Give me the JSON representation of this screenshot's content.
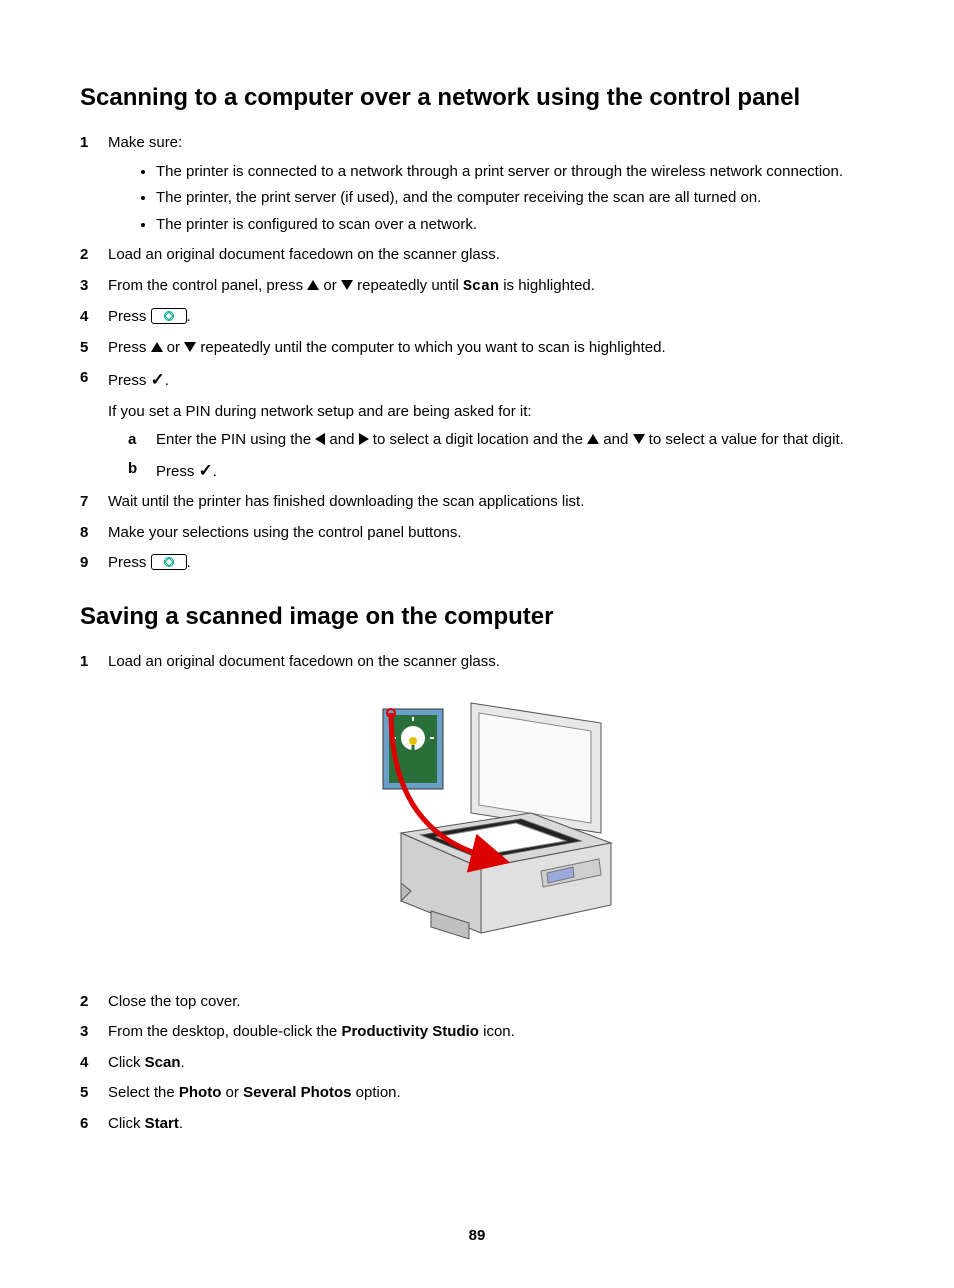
{
  "section1": {
    "heading": "Scanning to a computer over a network using the control panel",
    "step1_num": "1",
    "step1_text": "Make sure:",
    "step1_b1": "The printer is connected to a network through a print server or through the wireless network connection.",
    "step1_b2": "The printer, the print server (if used), and the computer receiving the scan are all turned on.",
    "step1_b3": "The printer is configured to scan over a network.",
    "step2_num": "2",
    "step2_text": "Load an original document facedown on the scanner glass.",
    "step3_num": "3",
    "step3_a": "From the control panel, press ",
    "step3_b": " or ",
    "step3_c": " repeatedly until ",
    "step3_scan": "Scan",
    "step3_d": " is highlighted.",
    "step4_num": "4",
    "step4_a": "Press ",
    "step4_b": ".",
    "step5_num": "5",
    "step5_a": "Press ",
    "step5_b": " or ",
    "step5_c": " repeatedly until the computer to which you want to scan is highlighted.",
    "step6_num": "6",
    "step6_a": "Press ",
    "step6_b": ".",
    "step6_note": "If you set a PIN during network setup and are being asked for it:",
    "step6_sub_a_l": "a",
    "step6_sub_a_1": "Enter the PIN using the ",
    "step6_sub_a_2": " and ",
    "step6_sub_a_3": " to select a digit location and the ",
    "step6_sub_a_4": " and ",
    "step6_sub_a_5": " to select a value for that digit.",
    "step6_sub_b_l": "b",
    "step6_sub_b_1": "Press ",
    "step6_sub_b_2": ".",
    "step7_num": "7",
    "step7_text": "Wait until the printer has finished downloading the scan applications list.",
    "step8_num": "8",
    "step8_text": "Make your selections using the control panel buttons.",
    "step9_num": "9",
    "step9_a": "Press ",
    "step9_b": "."
  },
  "section2": {
    "heading": "Saving a scanned image on the computer",
    "step1_num": "1",
    "step1_text": "Load an original document facedown on the scanner glass.",
    "step2_num": "2",
    "step2_text": "Close the top cover.",
    "step3_num": "3",
    "step3_a": "From the desktop, double-click the ",
    "step3_b": "Productivity Studio",
    "step3_c": " icon.",
    "step4_num": "4",
    "step4_a": "Click ",
    "step4_b": "Scan",
    "step4_c": ".",
    "step5_num": "5",
    "step5_a": "Select the ",
    "step5_b": "Photo",
    "step5_c": " or ",
    "step5_d": "Several Photos",
    "step5_e": " option.",
    "step6_num": "6",
    "step6_a": "Click ",
    "step6_b": "Start",
    "step6_c": "."
  },
  "page_number": "89"
}
